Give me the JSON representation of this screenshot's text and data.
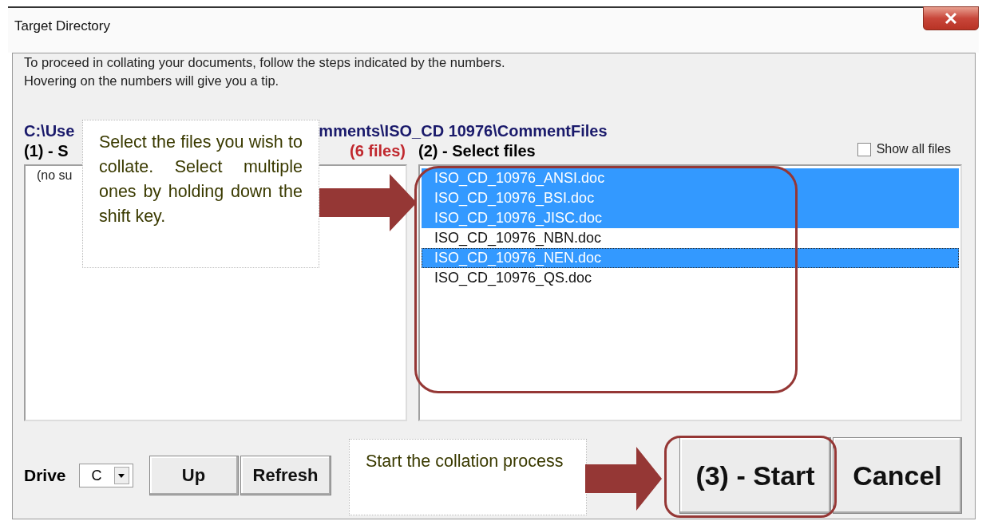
{
  "window": {
    "title": "Target Directory"
  },
  "intro": [
    "To proceed in collating your documents, follow the steps indicated by the numbers.",
    "Hovering on the numbers will give you a tip."
  ],
  "path": {
    "start": "C:\\Use",
    "end": "mments\\ISO_CD 10976\\CommentFiles"
  },
  "step1": {
    "label": "(1) - S",
    "count": "(6 files)",
    "items": [
      "(no su"
    ]
  },
  "step2": {
    "label": "(2) - Select files",
    "show_all": {
      "label": "Show all files",
      "checked": false
    },
    "files": [
      {
        "name": "ISO_CD_10976_ANSI.doc",
        "selected": true,
        "focused": false
      },
      {
        "name": "ISO_CD_10976_BSI.doc",
        "selected": true,
        "focused": false
      },
      {
        "name": "ISO_CD_10976_JISC.doc",
        "selected": true,
        "focused": false
      },
      {
        "name": "ISO_CD_10976_NBN.doc",
        "selected": false,
        "focused": false
      },
      {
        "name": "ISO_CD_10976_NEN.doc",
        "selected": true,
        "focused": true
      },
      {
        "name": "ISO_CD_10976_QS.doc",
        "selected": false,
        "focused": false
      }
    ]
  },
  "bottom": {
    "drive_label": "Drive",
    "drive_value": "C",
    "buttons": [
      "Up",
      "Refresh"
    ],
    "start": "(3) - Start",
    "cancel": "Cancel"
  },
  "callouts": [
    "Select the files you wish to collate. Select multiple ones by holding down the shift key.",
    "Start the collation process"
  ]
}
